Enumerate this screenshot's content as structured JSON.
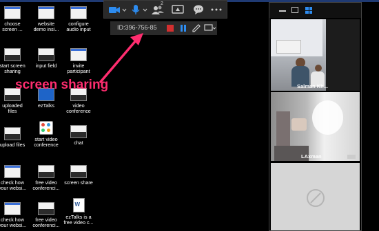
{
  "desktop": {
    "icons": [
      {
        "label1": "choose",
        "label2": "screen ..."
      },
      {
        "label1": "website",
        "label2": "demo insi..."
      },
      {
        "label1": "configure",
        "label2": "audio input"
      },
      {
        "label1": "start screen",
        "label2": "sharing"
      },
      {
        "label1": "input field",
        "label2": ""
      },
      {
        "label1": "invite",
        "label2": "participant"
      },
      {
        "label1": "uploaded",
        "label2": "files"
      },
      {
        "label1": "ezTalks",
        "label2": ""
      },
      {
        "label1": "video",
        "label2": "conference"
      },
      {
        "label1": "upload files",
        "label2": ""
      },
      {
        "label1": "start video",
        "label2": "conference"
      },
      {
        "label1": "chat",
        "label2": ""
      },
      {
        "label1": "check how",
        "label2": "your websi..."
      },
      {
        "label1": "free video",
        "label2": "conferenci..."
      },
      {
        "label1": "screen share",
        "label2": ""
      },
      {
        "label1": "check how",
        "label2": "your websi..."
      },
      {
        "label1": "free video",
        "label2": "conferenci..."
      },
      {
        "label1": "ezTalks is a",
        "label2": "free video c..."
      }
    ]
  },
  "meeting_toolbar": {
    "participant_count": "2",
    "icons": [
      "video-camera-icon",
      "microphone-icon",
      "participants-icon",
      "share-screen-icon",
      "chat-icon",
      "more-icon"
    ]
  },
  "screen_share_bar": {
    "meeting_id": "ID:396-756-85"
  },
  "annotation": {
    "text": "screen sharing",
    "color": "#ff2d6f"
  },
  "video_panel": {
    "participants": [
      {
        "name": "Salman Kh..."
      },
      {
        "name": "LAxman"
      }
    ]
  }
}
